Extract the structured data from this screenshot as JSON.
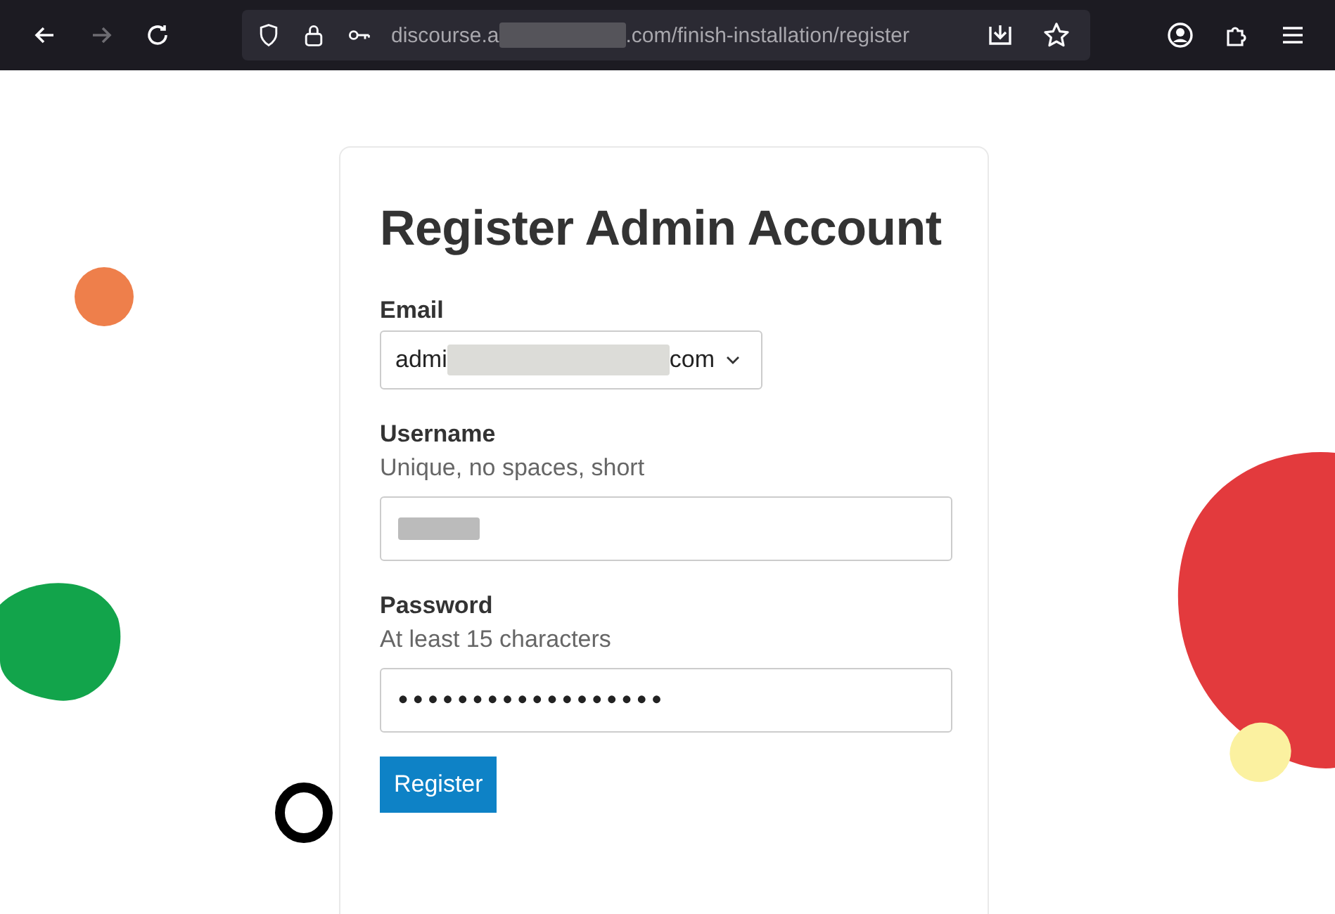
{
  "browser": {
    "back_enabled": true,
    "forward_enabled": false,
    "url_start": "discourse.a",
    "url_end": ".com/finish-installation/register",
    "url_redacted": true
  },
  "form": {
    "title": "Register Admin Account",
    "email": {
      "label": "Email",
      "value_start": "admi",
      "value_end": "com",
      "redacted": true
    },
    "username": {
      "label": "Username",
      "hint": "Unique, no spaces, short",
      "redacted": true
    },
    "password": {
      "label": "Password",
      "hint": "At least 15 characters",
      "mask": "••••••••••••••••••"
    },
    "button": "Register"
  }
}
